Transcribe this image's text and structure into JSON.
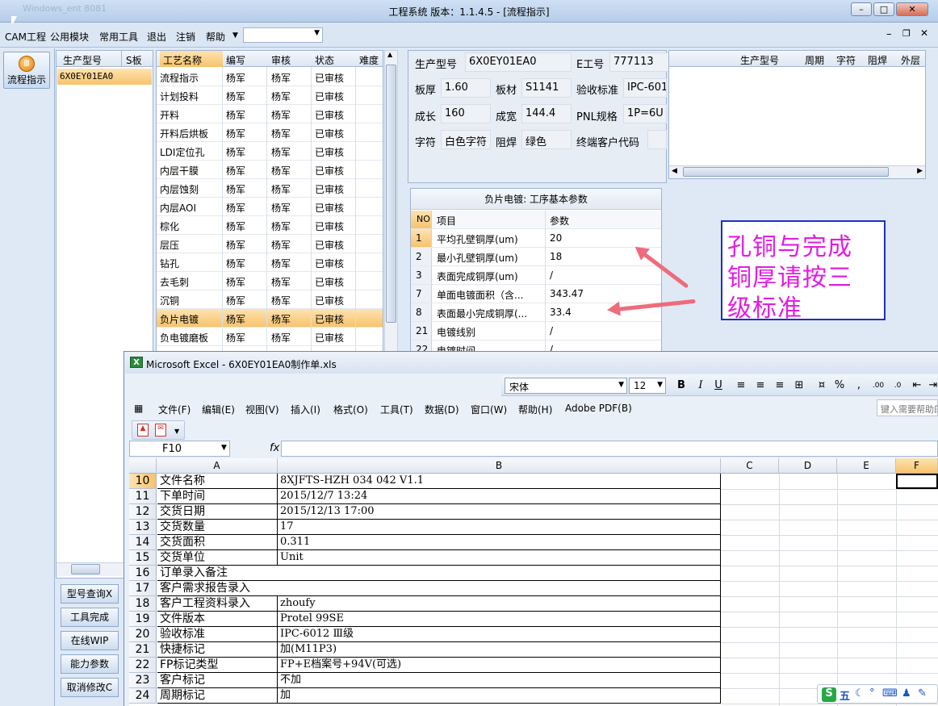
{
  "window": {
    "title": "工程系统    版本：1.1.4.5 - [流程指示]",
    "ghost_title": "Windows_ent 8081"
  },
  "menu": [
    "CAM工程",
    "公用模块",
    "常用工具",
    "退出",
    "注销",
    "帮助"
  ],
  "left": {
    "flow_button": "流程指示"
  },
  "model_panel": {
    "headers": [
      "生产型号",
      "S板"
    ],
    "row": "6X0EY01EA0"
  },
  "side_buttons": [
    "型号查询X",
    "工具完成",
    "在线WIP",
    "能力参数",
    "取消修改C"
  ],
  "process": {
    "headers": [
      "工艺名称",
      "编写",
      "审核",
      "状态",
      "难度"
    ],
    "rows": [
      [
        "流程指示",
        "杨军",
        "杨军",
        "已审核"
      ],
      [
        "计划投料",
        "杨军",
        "杨军",
        "已审核"
      ],
      [
        "开料",
        "杨军",
        "杨军",
        "已审核"
      ],
      [
        "开料后烘板",
        "杨军",
        "杨军",
        "已审核"
      ],
      [
        "LDI定位孔",
        "杨军",
        "杨军",
        "已审核"
      ],
      [
        "内层干膜",
        "杨军",
        "杨军",
        "已审核"
      ],
      [
        "内层蚀刻",
        "杨军",
        "杨军",
        "已审核"
      ],
      [
        "内层AOI",
        "杨军",
        "杨军",
        "已审核"
      ],
      [
        "棕化",
        "杨军",
        "杨军",
        "已审核"
      ],
      [
        "层压",
        "杨军",
        "杨军",
        "已审核"
      ],
      [
        "钻孔",
        "杨军",
        "杨军",
        "已审核"
      ],
      [
        "去毛刺",
        "杨军",
        "杨军",
        "已审核"
      ],
      [
        "沉铜",
        "杨军",
        "杨军",
        "已审核"
      ],
      [
        "负片电镀",
        "杨军",
        "杨军",
        "已审核"
      ],
      [
        "负电镀磨板",
        "杨军",
        "杨军",
        "已审核"
      ]
    ],
    "selected_index": 13
  },
  "info": {
    "labels": {
      "model": "生产型号",
      "eng": "E工号",
      "thick": "板厚",
      "material": "板材",
      "accept": "验收标准",
      "len": "成长",
      "wid": "成宽",
      "pnl": "PNL规格",
      "char": "字符",
      "mask": "阻焊",
      "cust": "终端客户代码"
    },
    "values": {
      "model": "6X0EY01EA0",
      "eng": "777113",
      "thick": "1.60",
      "material": "S1141",
      "accept": "IPC-601",
      "len": "160",
      "wid": "144.4",
      "pnl": "1P=6U",
      "char": "白色字符",
      "mask": "绿色",
      "cust": ""
    }
  },
  "right_grid": {
    "headers": [
      "生产型号",
      "周期",
      "字符",
      "阻焊",
      "外层"
    ]
  },
  "param": {
    "title": "负片电镀: 工序基本参数",
    "headers": [
      "NO",
      "项目",
      "参数"
    ],
    "rows": [
      [
        "1",
        "平均孔壁铜厚(um)",
        "20"
      ],
      [
        "2",
        "最小孔壁铜厚(um)",
        "18"
      ],
      [
        "3",
        "表面完成铜厚(um)",
        "/"
      ],
      [
        "7",
        "单面电镀面积（含...",
        "343.47"
      ],
      [
        "8",
        "表面最小完成铜厚(...",
        "33.4"
      ],
      [
        "21",
        "电镀线别",
        "/"
      ],
      [
        "22",
        "电镀时间",
        "/"
      ]
    ]
  },
  "note": {
    "lines": [
      "孔铜与完成",
      "铜厚请按三",
      "级标准"
    ],
    "color": "#e21de0"
  },
  "excel": {
    "title": "Microsoft Excel - 6X0EY01EA0制作单.xls",
    "font": "宋体",
    "font_size": "12",
    "menu": [
      "文件(F)",
      "编辑(E)",
      "视图(V)",
      "插入(I)",
      "格式(O)",
      "工具(T)",
      "数据(D)",
      "窗口(W)",
      "帮助(H)",
      "Adobe PDF(B)"
    ],
    "help_placeholder": "键入需要帮助的问题",
    "name_box": "F10",
    "fx": "fx",
    "columns": [
      "A",
      "B",
      "C",
      "D",
      "E",
      "F"
    ],
    "rows": [
      {
        "n": "10",
        "a": "文件名称",
        "b": "8XJFTS-HZH 034 042 V1.1"
      },
      {
        "n": "11",
        "a": "下单时间",
        "b": "2015/12/7 13:24"
      },
      {
        "n": "12",
        "a": "交货日期",
        "b": "2015/12/13 17:00"
      },
      {
        "n": "13",
        "a": "交货数量",
        "b": "17"
      },
      {
        "n": "14",
        "a": "交货面积",
        "b": "0.311"
      },
      {
        "n": "15",
        "a": "交货单位",
        "b": "Unit"
      },
      {
        "n": "16",
        "a": "订单录入备注",
        "b": ""
      },
      {
        "n": "17",
        "a": "客户需求报告录入",
        "b": ""
      },
      {
        "n": "18",
        "a": "客户工程资料录入",
        "b": "zhoufy"
      },
      {
        "n": "19",
        "a": "文件版本",
        "b": "Protel 99SE"
      },
      {
        "n": "20",
        "a": "验收标准",
        "b": "IPC-6012 Ⅲ级"
      },
      {
        "n": "21",
        "a": "快捷标记",
        "b": "加(M11P3)"
      },
      {
        "n": "22",
        "a": "FP标记类型",
        "b": "FP+E档案号+94V(可选)"
      },
      {
        "n": "23",
        "a": "客户标记",
        "b": "不加"
      },
      {
        "n": "24",
        "a": "周期标记",
        "b": "加"
      }
    ]
  },
  "tray": [
    "S",
    "五"
  ]
}
